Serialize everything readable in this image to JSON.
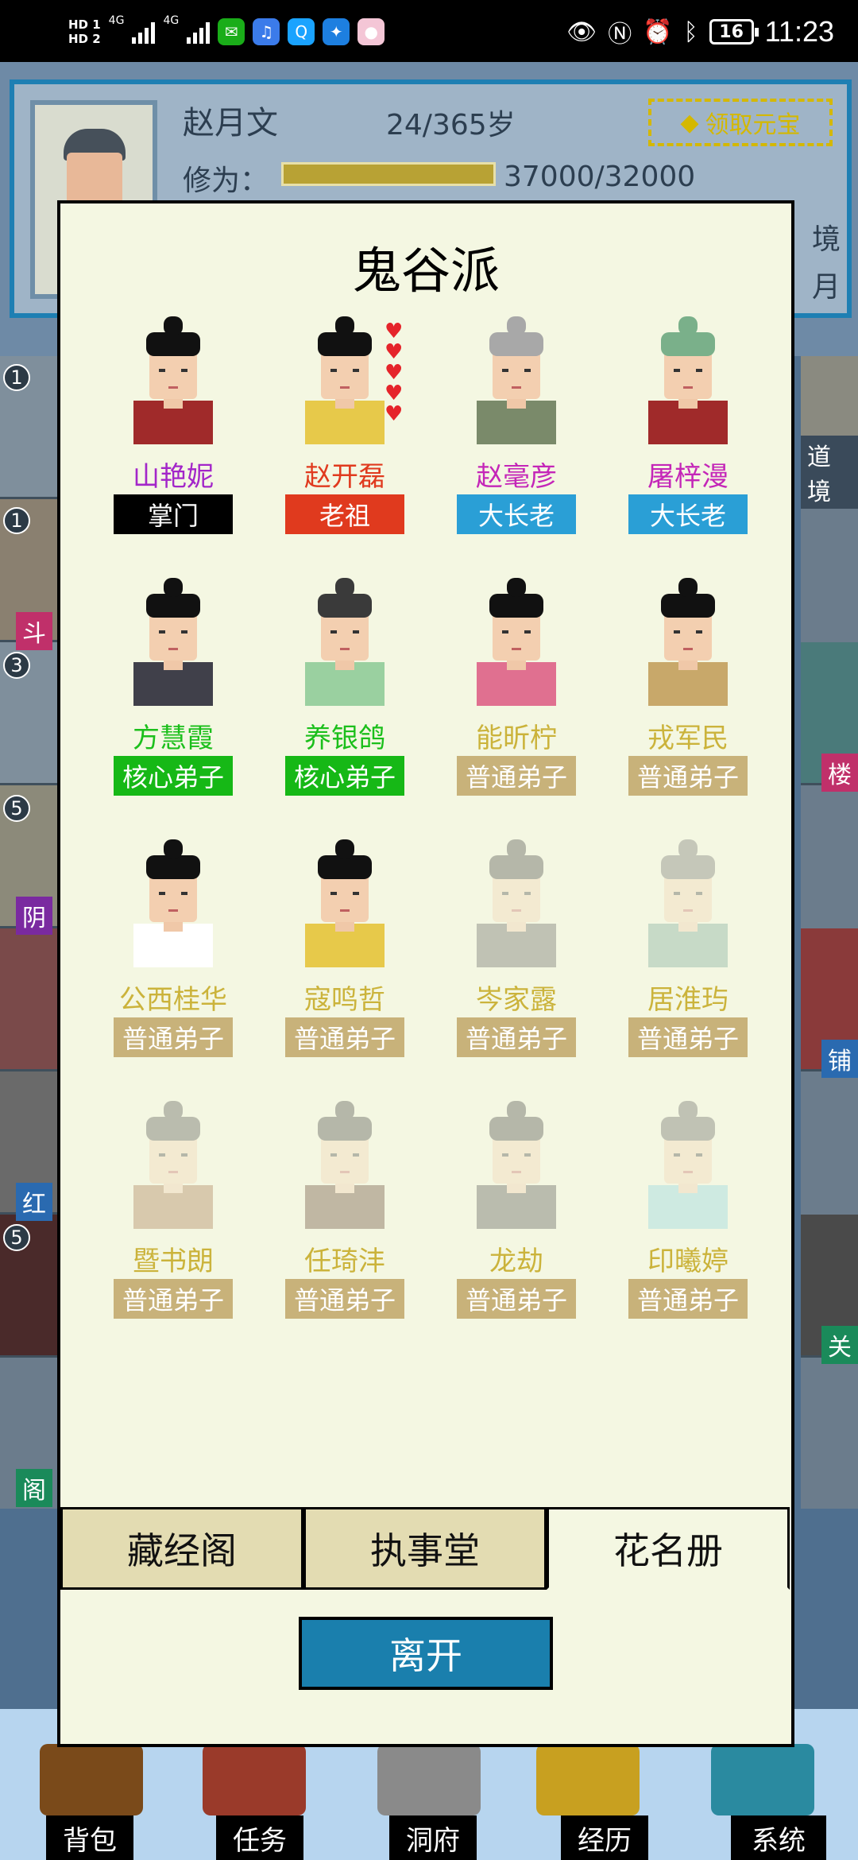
{
  "status_bar": {
    "hd1": "HD 1",
    "hd2": "HD 2",
    "net1": "4G",
    "net2": "4G",
    "battery": "16",
    "time": "11:23",
    "app_icons": [
      "wechat-icon",
      "music-icon",
      "qq-icon",
      "bulb-icon",
      "assistant-icon"
    ],
    "status_icons": [
      "eye-icon",
      "nfc-icon",
      "alarm-icon",
      "bluetooth-icon"
    ]
  },
  "profile": {
    "name": "赵月文",
    "age": "24/365岁",
    "claim_label": "领取元宝",
    "cultivation_label": "修为：",
    "cultivation_value": "37000/32000",
    "side_1": "境",
    "side_2": "月"
  },
  "background": {
    "left_numbers": [
      "1",
      "1",
      "3",
      "5",
      "5"
    ],
    "left_labels": [
      "斗",
      "阴",
      "红",
      "阁"
    ],
    "right_labels": [
      "道境",
      "楼",
      "铺",
      "关"
    ]
  },
  "dialog": {
    "title": "鬼谷派",
    "members": [
      {
        "name": "山艳妮",
        "rank": "掌门",
        "name_color": "#a326c9",
        "rank_color": "#000000",
        "hair": "#111111",
        "robe": "#a02a2a",
        "faded": false
      },
      {
        "name": "赵开磊",
        "rank": "老祖",
        "name_color": "#e03a1e",
        "rank_color": "#e03a1e",
        "hair": "#111111",
        "robe": "#e7c94a",
        "faded": false,
        "hearts": 5
      },
      {
        "name": "赵毫彦",
        "rank": "大长老",
        "name_color": "#c426b8",
        "rank_color": "#2a9fd6",
        "hair": "#a8a8a8",
        "robe": "#7a8a6a",
        "faded": false
      },
      {
        "name": "屠梓漫",
        "rank": "大长老",
        "name_color": "#c426b8",
        "rank_color": "#2a9fd6",
        "hair": "#7ab08a",
        "robe": "#a02a2a",
        "faded": false
      },
      {
        "name": "方慧霞",
        "rank": "核心弟子",
        "name_color": "#1bbf1b",
        "rank_color": "#16b816",
        "hair": "#111111",
        "robe": "#40404a",
        "faded": false
      },
      {
        "name": "养银鸽",
        "rank": "核心弟子",
        "name_color": "#1bbf1b",
        "rank_color": "#16b816",
        "hair": "#3a3a3a",
        "robe": "#9ad0a0",
        "faded": false
      },
      {
        "name": "能昕柠",
        "rank": "普通弟子",
        "name_color": "#cbb33b",
        "rank_color": "#c8b27a",
        "hair": "#111111",
        "robe": "#e07090",
        "faded": false
      },
      {
        "name": "戎军民",
        "rank": "普通弟子",
        "name_color": "#cbb33b",
        "rank_color": "#c8b27a",
        "hair": "#111111",
        "robe": "#c8a86a",
        "faded": false
      },
      {
        "name": "公西桂华",
        "rank": "普通弟子",
        "name_color": "#cbb33b",
        "rank_color": "#c8b27a",
        "hair": "#111111",
        "robe": "#ffffff",
        "faded": false
      },
      {
        "name": "寇鸣哲",
        "rank": "普通弟子",
        "name_color": "#cbb33b",
        "rank_color": "#c8b27a",
        "hair": "#111111",
        "robe": "#e7c94a",
        "faded": false
      },
      {
        "name": "岑家露",
        "rank": "普通弟子",
        "name_color": "#cbb33b",
        "rank_color": "#c8b27a",
        "hair": "#333333",
        "robe": "#555555",
        "faded": true
      },
      {
        "name": "居淮玙",
        "rank": "普通弟子",
        "name_color": "#cbb33b",
        "rank_color": "#c8b27a",
        "hair": "#666666",
        "robe": "#6aa090",
        "faded": true
      },
      {
        "name": "暨书朗",
        "rank": "普通弟子",
        "name_color": "#cbb33b",
        "rank_color": "#c8b27a",
        "hair": "#444444",
        "robe": "#a06a40",
        "faded": true
      },
      {
        "name": "任琦沣",
        "rank": "普通弟子",
        "name_color": "#cbb33b",
        "rank_color": "#c8b27a",
        "hair": "#333333",
        "robe": "#553322",
        "faded": true
      },
      {
        "name": "龙劫",
        "rank": "普通弟子",
        "name_color": "#cbb33b",
        "rank_color": "#c8b27a",
        "hair": "#333333",
        "robe": "#444444",
        "faded": true
      },
      {
        "name": "印曦婷",
        "rank": "普通弟子",
        "name_color": "#cbb33b",
        "rank_color": "#c8b27a",
        "hair": "#555555",
        "robe": "#80d0e0",
        "faded": true
      }
    ],
    "tabs": [
      {
        "label": "藏经阁",
        "active": false
      },
      {
        "label": "执事堂",
        "active": false
      },
      {
        "label": "花名册",
        "active": true
      }
    ],
    "leave_label": "离开"
  },
  "bottom_nav": {
    "items": [
      "背包",
      "任务",
      "洞府",
      "经历",
      "系统"
    ]
  }
}
